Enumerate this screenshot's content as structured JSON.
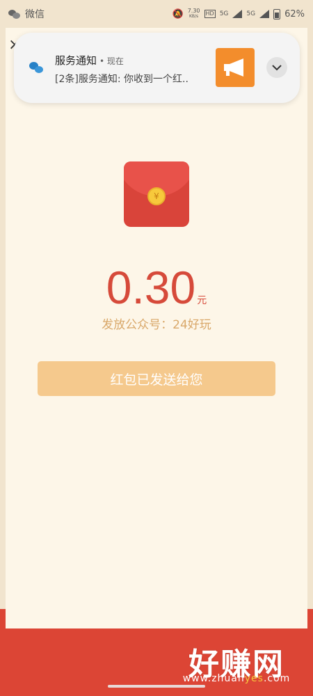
{
  "status_bar": {
    "app_label": "微信",
    "net_speed_value": "7.30",
    "net_speed_unit": "KB/s",
    "network_1": "5G",
    "network_2": "5G",
    "battery_percent": "62%"
  },
  "page": {
    "close_glyph": "×",
    "amount": "0.30",
    "amount_unit": "元",
    "sender": "发放公众号：24好玩",
    "button_label": "红包已发送给您"
  },
  "notification": {
    "title": "服务通知",
    "time": "• 现在",
    "body": "[2条]服务通知: 你收到一个红..",
    "expand_icon": "chevron-down-icon",
    "thumbnail_icon": "megaphone-icon"
  },
  "watermark": {
    "text": "好赚网",
    "url_prefix": "www.zhuan",
    "url_highlight": "yes",
    "url_suffix": ".com"
  },
  "colors": {
    "accent_red": "#d64a3a",
    "button_bg": "#f5c98d",
    "page_bg": "#fdf6e8",
    "notification_thumb": "#f38d2c"
  }
}
